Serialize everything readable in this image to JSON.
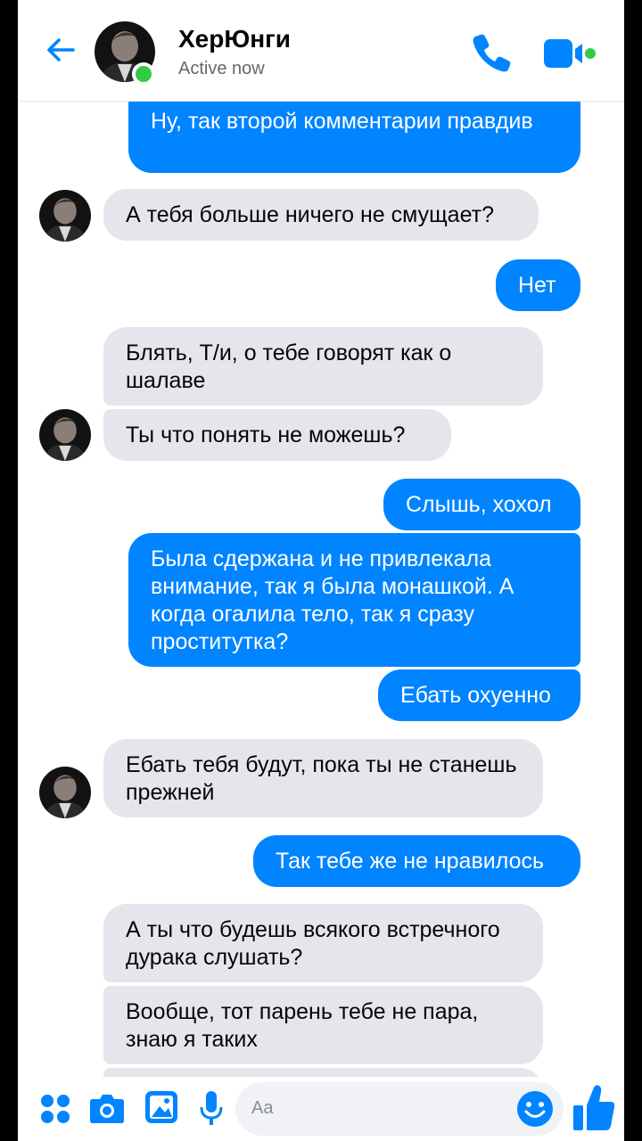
{
  "contact": {
    "name": "ХерЮнги",
    "status": "Active now"
  },
  "colors": {
    "accent": "#0084ff",
    "incoming_bubble": "#e4e6eb",
    "online": "#31cc46"
  },
  "icons": {
    "back": "arrow-left-icon",
    "call": "phone-icon",
    "video": "video-camera-icon",
    "menu": "four-dots-icon",
    "camera": "camera-icon",
    "gallery": "image-icon",
    "mic": "microphone-icon",
    "emoji": "smiley-icon",
    "like": "thumbs-up-icon"
  },
  "messages": [
    {
      "dir": "out",
      "text": "Ну, так второй комментарии правдив"
    },
    {
      "dir": "in",
      "text": "А тебя больше ничего не смущает?"
    },
    {
      "dir": "out",
      "text": "Нет"
    },
    {
      "dir": "in",
      "text": "Блять, Т/и, о тебе говорят как о шалаве"
    },
    {
      "dir": "in",
      "text": "Ты что понять не можешь?"
    },
    {
      "dir": "out",
      "text": "Слышь, хохол"
    },
    {
      "dir": "out",
      "text": "Была сдержана и не привлекала внимание, так я была монашкой. А когда огалила тело, так я сразу проститутка?"
    },
    {
      "dir": "out",
      "text": "Ебать охуенно"
    },
    {
      "dir": "in",
      "text": "Ебать тебя будут, пока ты не станешь прежней"
    },
    {
      "dir": "out",
      "text": "Так тебе же не нравилось"
    },
    {
      "dir": "in",
      "text": "А ты что будешь всякого встречного дурака слушать?"
    },
    {
      "dir": "in",
      "text": "Вообще, тот парень тебе не пара, знаю я таких"
    }
  ],
  "composer": {
    "placeholder": "Aa"
  }
}
